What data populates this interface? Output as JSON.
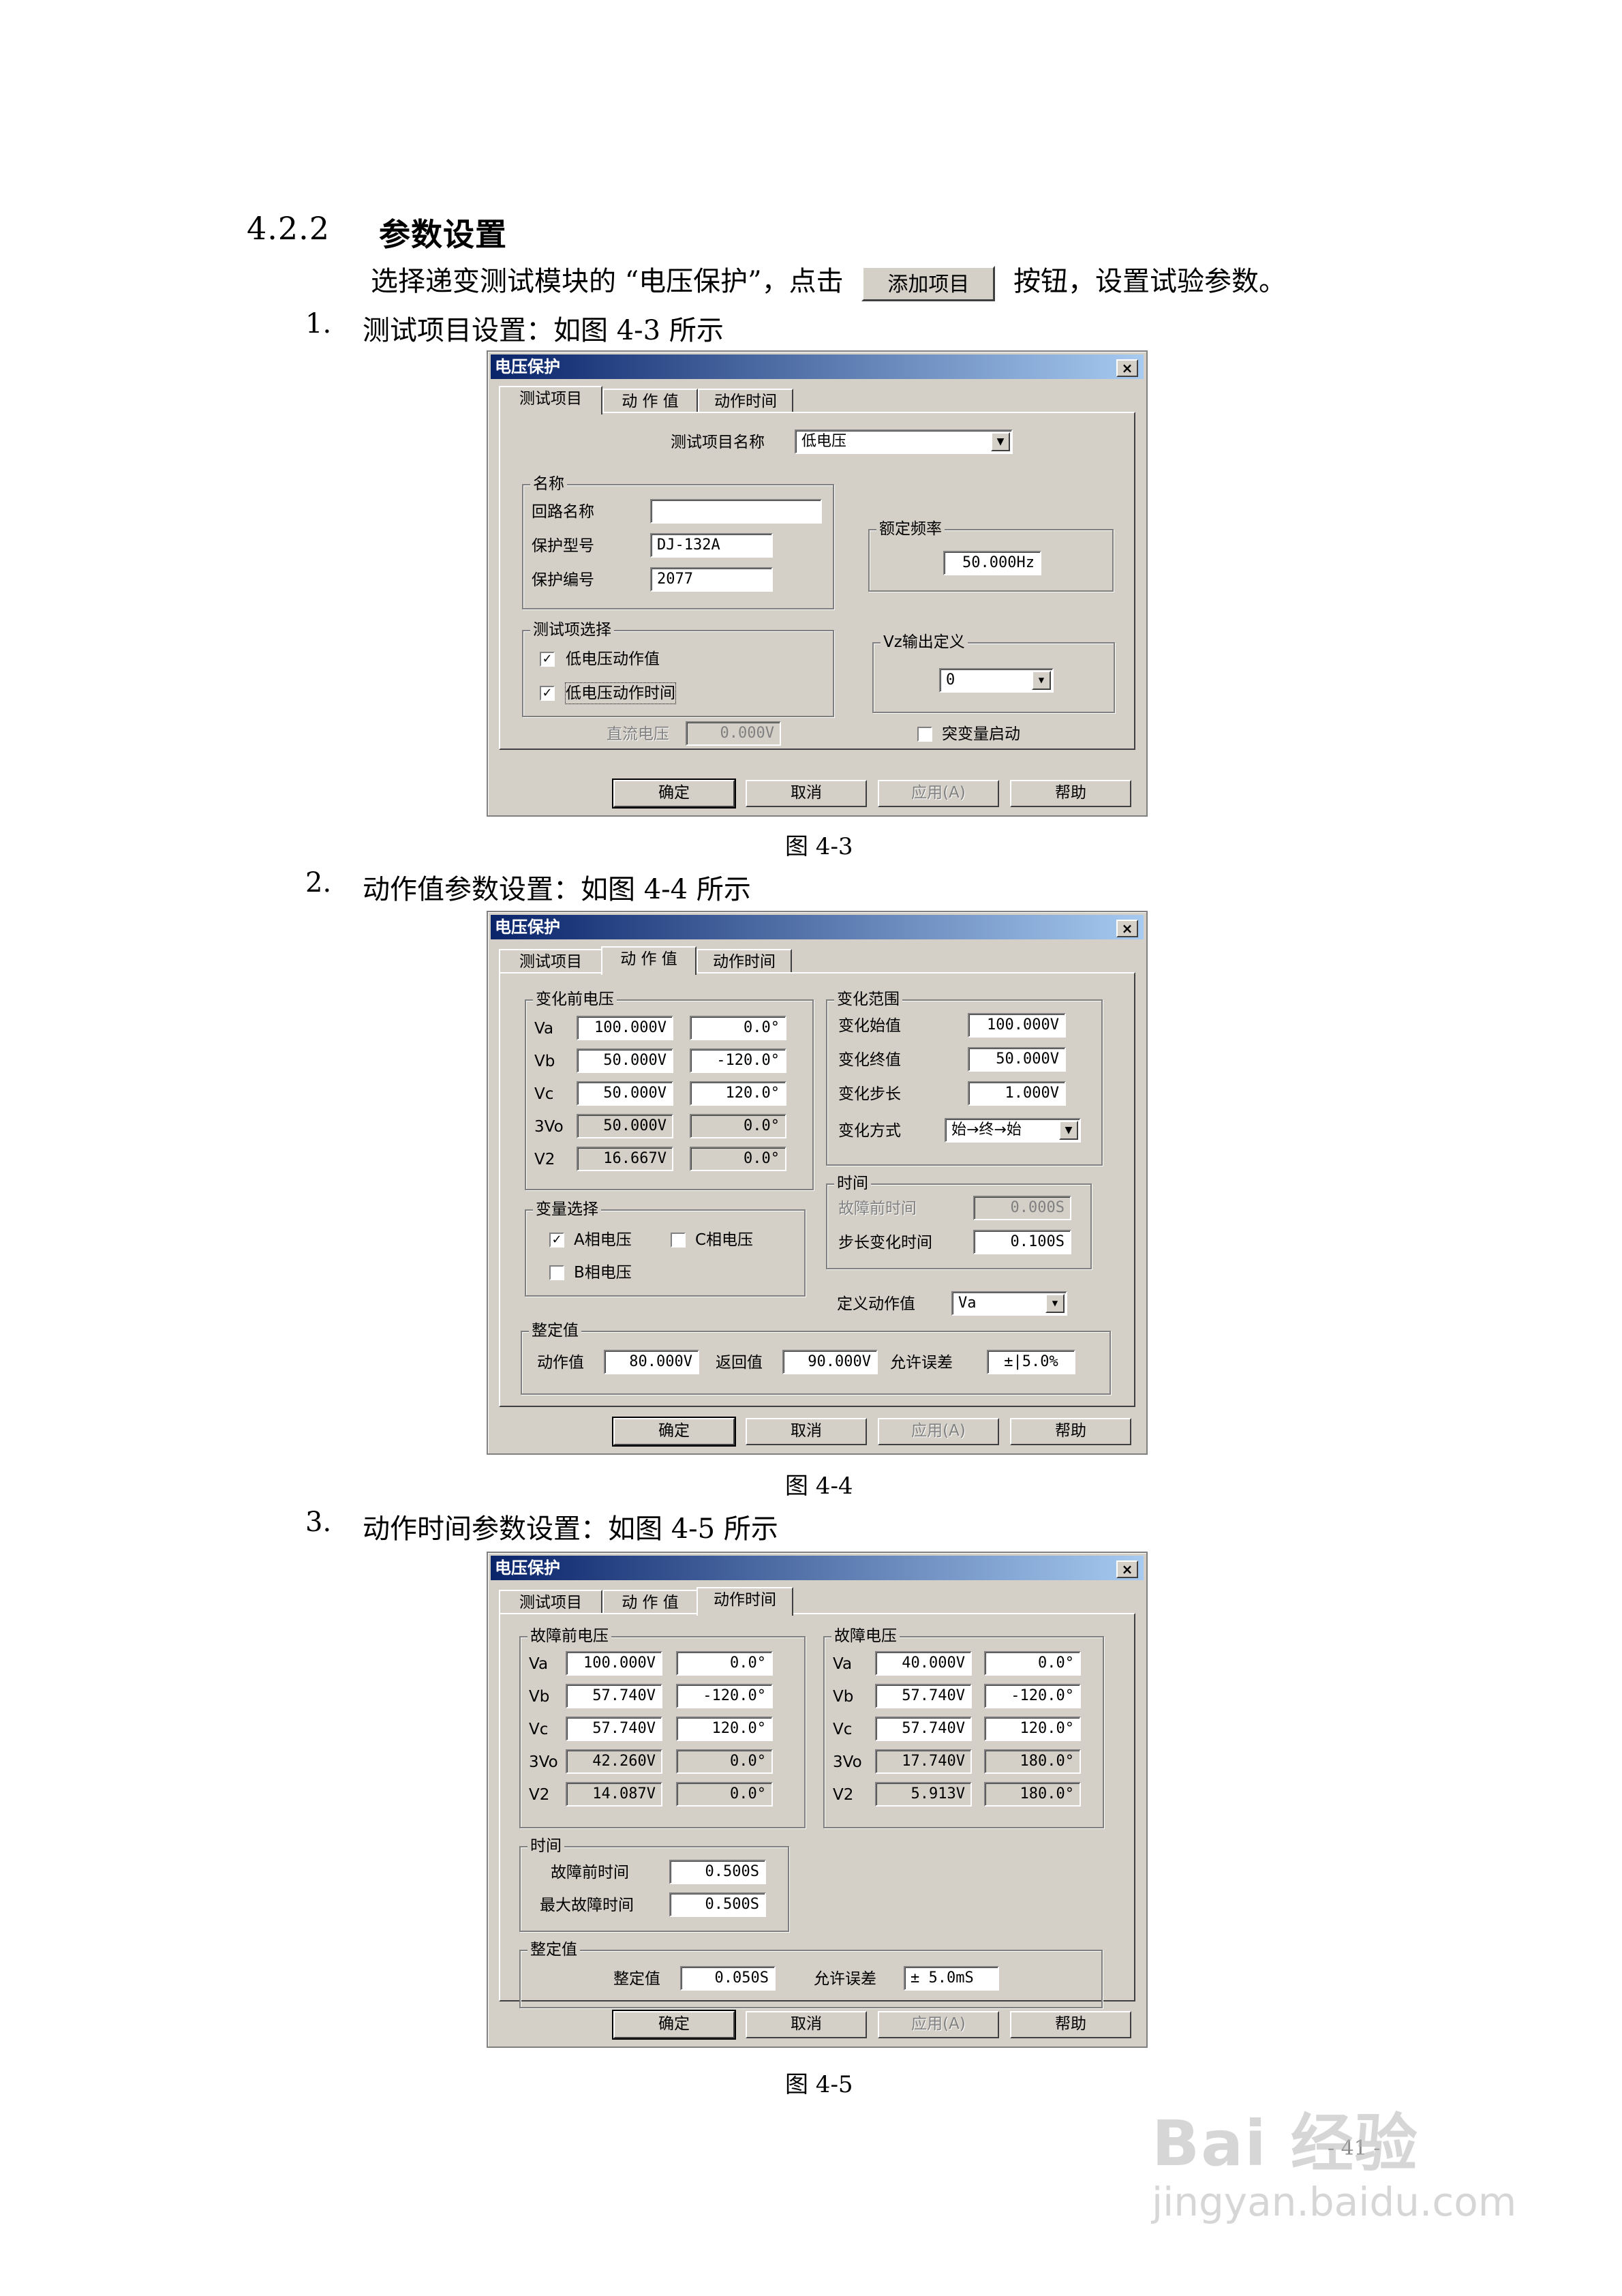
{
  "section": {
    "number": "4.2.2",
    "title": "参数设置"
  },
  "intro": {
    "before": "选择递变测试模块的 “电压保护”，点击",
    "button": "添加项目",
    "after": "按钮，设置试验参数。"
  },
  "items": [
    {
      "num": "1.",
      "text": "测试项目设置：如图 4-3 所示"
    },
    {
      "num": "2.",
      "text": "动作值参数设置：如图 4-4 所示"
    },
    {
      "num": "3.",
      "text": "动作时间参数设置：如图 4-5 所示"
    }
  ],
  "captions": [
    "图 4-3",
    "图 4-4",
    "图 4-5"
  ],
  "dialog": {
    "title": "电压保护",
    "close": "×",
    "tabs": [
      "测试项目",
      "动 作 值",
      "动作时间"
    ],
    "buttons": {
      "ok": "确定",
      "cancel": "取消",
      "apply": "应用(A)",
      "help": "帮助"
    }
  },
  "fig3": {
    "test_item_label": "测试项目名称",
    "test_item_value": "低电压",
    "name_group": "名称",
    "circuit_label": "回路名称",
    "circuit_value": "",
    "model_label": "保护型号",
    "model_value": "DJ-132A",
    "serial_label": "保护编号",
    "serial_value": "2077",
    "freq_group": "额定频率",
    "freq_value": "50.000Hz",
    "select_group": "测试项选择",
    "check1": "低电压动作值",
    "check2": "低电压动作时间",
    "vz_group": "Vz输出定义",
    "vz_value": "0",
    "dc_label": "直流电压",
    "dc_value": "0.000V",
    "sudden_label": "突变量启动"
  },
  "fig4": {
    "pre_group": "变化前电压",
    "rows": [
      {
        "name": "Va",
        "mag": "100.000V",
        "ang": "0.0°"
      },
      {
        "name": "Vb",
        "mag": "50.000V",
        "ang": "-120.0°"
      },
      {
        "name": "Vc",
        "mag": "50.000V",
        "ang": "120.0°"
      },
      {
        "name": "3Vo",
        "mag": "50.000V",
        "ang": "0.0°"
      },
      {
        "name": "V2",
        "mag": "16.667V",
        "ang": "0.0°"
      }
    ],
    "range_group": "变化范围",
    "start_label": "变化始值",
    "start_value": "100.000V",
    "end_label": "变化终值",
    "end_value": "50.000V",
    "step_label": "变化步长",
    "step_value": "1.000V",
    "mode_label": "变化方式",
    "mode_value": "始→终→始",
    "time_group": "时间",
    "prefault_label": "故障前时间",
    "prefault_value": "0.000S",
    "steptime_label": "步长变化时间",
    "steptime_value": "0.100S",
    "var_group": "变量选择",
    "var_a": "A相电压",
    "var_c": "C相电压",
    "var_b": "B相电压",
    "define_label": "定义动作值",
    "define_value": "Va",
    "set_group": "整定值",
    "act_label": "动作值",
    "act_value": "80.000V",
    "ret_label": "返回值",
    "ret_value": "90.000V",
    "err_label": "允许误差",
    "err_value": "±|5.0%"
  },
  "fig5": {
    "pre_group": "故障前电压",
    "pre_rows": [
      {
        "name": "Va",
        "mag": "100.000V",
        "ang": "0.0°"
      },
      {
        "name": "Vb",
        "mag": "57.740V",
        "ang": "-120.0°"
      },
      {
        "name": "Vc",
        "mag": "57.740V",
        "ang": "120.0°"
      },
      {
        "name": "3Vo",
        "mag": "42.260V",
        "ang": "0.0°"
      },
      {
        "name": "V2",
        "mag": "14.087V",
        "ang": "0.0°"
      }
    ],
    "fault_group": "故障电压",
    "fault_rows": [
      {
        "name": "Va",
        "mag": "40.000V",
        "ang": "0.0°"
      },
      {
        "name": "Vb",
        "mag": "57.740V",
        "ang": "-120.0°"
      },
      {
        "name": "Vc",
        "mag": "57.740V",
        "ang": "120.0°"
      },
      {
        "name": "3Vo",
        "mag": "17.740V",
        "ang": "180.0°"
      },
      {
        "name": "V2",
        "mag": "5.913V",
        "ang": "180.0°"
      }
    ],
    "time_group": "时间",
    "prefault_label": "故障前时间",
    "prefault_value": "0.500S",
    "maxfault_label": "最大故障时间",
    "maxfault_value": "0.500S",
    "set_group": "整定值",
    "set_label": "整定值",
    "set_value": "0.050S",
    "err_label": "允许误差",
    "err_value": "± 5.0mS"
  },
  "page_number": "- 41 -",
  "watermark": {
    "brand": "Bai 经验",
    "url": "jingyan.baidu.com"
  }
}
